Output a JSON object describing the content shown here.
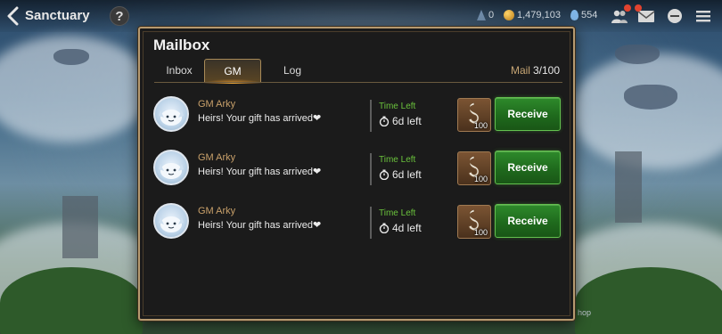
{
  "topbar": {
    "title": "Sanctuary",
    "help": "?",
    "resources": [
      {
        "icon": "stamina-icon",
        "value": "0"
      },
      {
        "icon": "gold-icon",
        "value": "1,479,103"
      },
      {
        "icon": "skystone-icon",
        "value": "554"
      }
    ]
  },
  "mailbox": {
    "title": "Mailbox",
    "tabs": [
      {
        "label": "Inbox",
        "active": false
      },
      {
        "label": "GM",
        "active": true
      },
      {
        "label": "Log",
        "active": false
      }
    ],
    "count_label": "Mail",
    "count_value": "3/100",
    "mails": [
      {
        "sender": "GM Arky",
        "message": "Heirs! Your gift has arrived❤",
        "time_label": "Time Left",
        "time_value": "6d left",
        "reward_qty": "100",
        "button": "Receive"
      },
      {
        "sender": "GM Arky",
        "message": "Heirs! Your gift has arrived❤",
        "time_label": "Time Left",
        "time_value": "6d left",
        "reward_qty": "100",
        "button": "Receive"
      },
      {
        "sender": "GM Arky",
        "message": "Heirs! Your gift has arrived❤",
        "time_label": "Time Left",
        "time_value": "4d left",
        "reward_qty": "100",
        "button": "Receive"
      }
    ]
  },
  "background_hint": "hop",
  "colors": {
    "accent_gold": "#b79a70",
    "time_green": "#6ac23c",
    "receive_green": "#2e8a2b",
    "sender_gold": "#c8a06a"
  }
}
